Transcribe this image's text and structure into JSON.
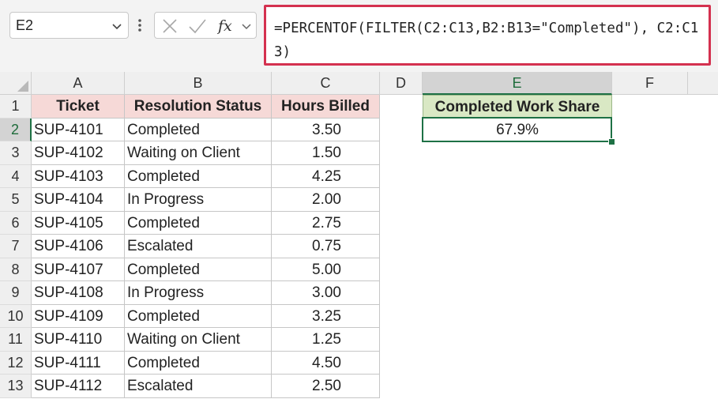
{
  "name_box": {
    "value": "E2"
  },
  "formula_bar": {
    "formula": "=PERCENTOF(FILTER(C2:C13,B2:B13=\"Completed\"), C2:C13)",
    "cancel_icon": "x-icon",
    "enter_icon": "checkmark-icon",
    "function_icon": "fx-icon"
  },
  "accent_color": "#1e7145",
  "highlight_color": "#d4314f",
  "columns": [
    {
      "label": "A"
    },
    {
      "label": "B"
    },
    {
      "label": "C"
    },
    {
      "label": "D"
    },
    {
      "label": "E"
    },
    {
      "label": "F"
    }
  ],
  "rows": [
    "1",
    "2",
    "3",
    "4",
    "5",
    "6",
    "7",
    "8",
    "9",
    "10",
    "11",
    "12",
    "13"
  ],
  "table": {
    "headers": {
      "ticket": "Ticket",
      "status": "Resolution Status",
      "hours": "Hours Billed"
    },
    "records": [
      {
        "ticket": "SUP-4101",
        "status": "Completed",
        "hours": "3.50"
      },
      {
        "ticket": "SUP-4102",
        "status": "Waiting on Client",
        "hours": "1.50"
      },
      {
        "ticket": "SUP-4103",
        "status": "Completed",
        "hours": "4.25"
      },
      {
        "ticket": "SUP-4104",
        "status": "In Progress",
        "hours": "2.00"
      },
      {
        "ticket": "SUP-4105",
        "status": "Completed",
        "hours": "2.75"
      },
      {
        "ticket": "SUP-4106",
        "status": "Escalated",
        "hours": "0.75"
      },
      {
        "ticket": "SUP-4107",
        "status": "Completed",
        "hours": "5.00"
      },
      {
        "ticket": "SUP-4108",
        "status": "In Progress",
        "hours": "3.00"
      },
      {
        "ticket": "SUP-4109",
        "status": "Completed",
        "hours": "3.25"
      },
      {
        "ticket": "SUP-4110",
        "status": "Waiting on Client",
        "hours": "1.25"
      },
      {
        "ticket": "SUP-4111",
        "status": "Completed",
        "hours": "4.50"
      },
      {
        "ticket": "SUP-4112",
        "status": "Escalated",
        "hours": "2.50"
      }
    ]
  },
  "result": {
    "header": "Completed Work Share",
    "value": "67.9%"
  }
}
